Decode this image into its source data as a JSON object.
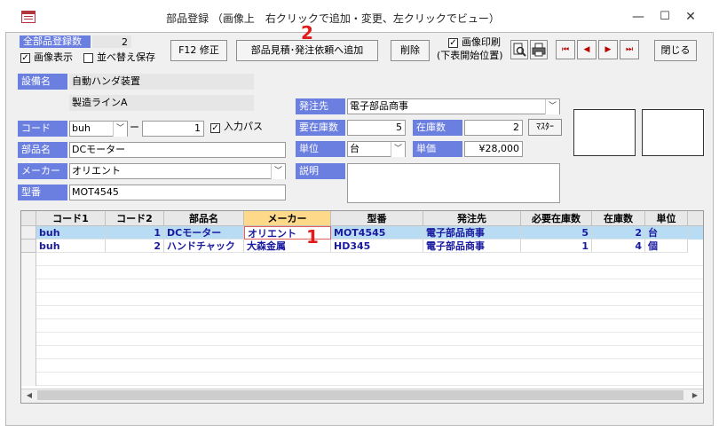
{
  "window": {
    "title": "部品登録 （画像上　右クリックで追加・変更、左クリックでビュー）",
    "minimize": "—",
    "maximize": "☐",
    "close": "✕"
  },
  "summary": {
    "label": "全部品登録数",
    "count": "2"
  },
  "options": {
    "show_image": "画像表示",
    "sort_save": "並べ替え保存",
    "print_image": "画像印刷",
    "print_note": "(下表開始位置)"
  },
  "toolbar": {
    "f12": "F12 修正",
    "add_quote": "部品見積･発注依頼へ追加",
    "delete": "削除",
    "close": "閉じる",
    "nav_first": "⏮",
    "nav_prev": "◀",
    "nav_next": "▶",
    "nav_last": "⏭"
  },
  "form": {
    "equipment_label": "設備名",
    "equipment_value": "自動ハンダ装置",
    "line_value": "製造ラインA",
    "code_label": "コード",
    "code1": "buh",
    "code_dash": "ー",
    "code2": "1",
    "input_pass": "入力パス",
    "partname_label": "部品名(必)",
    "partname_value": "DCモーター",
    "maker_label": "メーカー",
    "maker_value": "オリエント",
    "model_label": "型番",
    "model_value": "MOT4545",
    "supplier_label": "発注先",
    "supplier_value": "電子部品商事",
    "req_stock_label": "要在庫数",
    "req_stock_value": "5",
    "stock_label": "在庫数",
    "stock_value": "2",
    "master_btn": "ﾏｽﾀｰ",
    "unit_label": "単位",
    "unit_value": "台",
    "price_label": "単価",
    "price_value": "¥28,000",
    "desc_label": "説明",
    "desc_value": ""
  },
  "grid": {
    "columns": [
      "コード1",
      "コード2",
      "部品名",
      "メーカー",
      "型番",
      "発注先",
      "必要在庫数",
      "在庫数",
      "単位"
    ],
    "rows": [
      [
        "buh",
        "1",
        "DCモーター",
        "オリエント",
        "MOT4545",
        "電子部品商事",
        "5",
        "2",
        "台"
      ],
      [
        "buh",
        "2",
        "ハンドチャック",
        "大森金属",
        "HD345",
        "電子部品商事",
        "1",
        "4",
        "個"
      ]
    ]
  },
  "annotations": {
    "one": "1",
    "two": "2"
  },
  "colors": {
    "label_blue": "#6b7fe0",
    "selected_row": "#b9dcf5",
    "selected_header": "#ffd98a",
    "data_text": "#1a1a9e",
    "annotation_red": "#e01b1b"
  }
}
